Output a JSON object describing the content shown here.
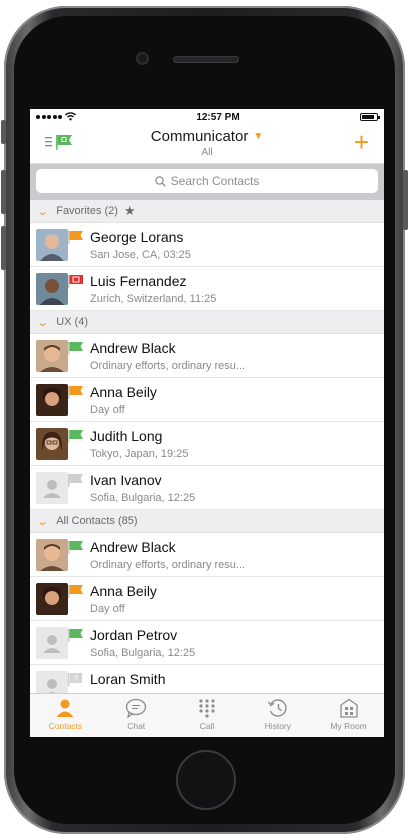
{
  "status": {
    "time": "12:57 PM"
  },
  "nav": {
    "title": "Communicator",
    "subtitle": "All",
    "add_label": "+"
  },
  "search": {
    "placeholder": "Search Contacts"
  },
  "sections": [
    {
      "label": "Favorites (2)",
      "contacts": [
        {
          "name": "George Lorans",
          "detail": "San Jose, CA, 03:25",
          "status": "away",
          "status_color": "#f39a1e"
        },
        {
          "name": "Luis Fernandez",
          "detail": "Zurich, Switzerland, 11:25",
          "status": "busy",
          "status_color": "#e03030"
        }
      ]
    },
    {
      "label": "UX (4)",
      "contacts": [
        {
          "name": "Andrew Black",
          "detail": "Ordinary efforts, ordinary resu...",
          "status": "available",
          "status_color": "#5cb85c"
        },
        {
          "name": "Anna Beily",
          "detail": "Day off",
          "status": "away",
          "status_color": "#f39a1e"
        },
        {
          "name": "Judith Long",
          "detail": "Tokyo, Japan, 19:25",
          "status": "available",
          "status_color": "#5cb85c"
        },
        {
          "name": "Ivan Ivanov",
          "detail": "Sofia, Bulgaria, 12:25",
          "status": "offline",
          "status_color": "#cfcfcf"
        }
      ]
    },
    {
      "label": "All Contacts (85)",
      "contacts": [
        {
          "name": "Andrew Black",
          "detail": "Ordinary efforts, ordinary resu...",
          "status": "available",
          "status_color": "#5cb85c"
        },
        {
          "name": "Anna Beily",
          "detail": "Day off",
          "status": "away",
          "status_color": "#f39a1e"
        },
        {
          "name": "Jordan Petrov",
          "detail": "Sofia, Bulgaria, 12:25",
          "status": "available",
          "status_color": "#5cb85c"
        },
        {
          "name": "Loran Smith",
          "detail": "",
          "status": "unknown",
          "status_color": "#cfcfcf"
        }
      ]
    }
  ],
  "tabs": [
    {
      "label": "Contacts",
      "icon": "person-icon"
    },
    {
      "label": "Chat",
      "icon": "chat-bubble-icon"
    },
    {
      "label": "Call",
      "icon": "dialpad-icon"
    },
    {
      "label": "History",
      "icon": "history-clock-icon"
    },
    {
      "label": "My Room",
      "icon": "room-icon"
    }
  ],
  "colors": {
    "accent": "#f39a1e",
    "available": "#5cb85c",
    "busy": "#e03030",
    "offline": "#cfcfcf"
  }
}
